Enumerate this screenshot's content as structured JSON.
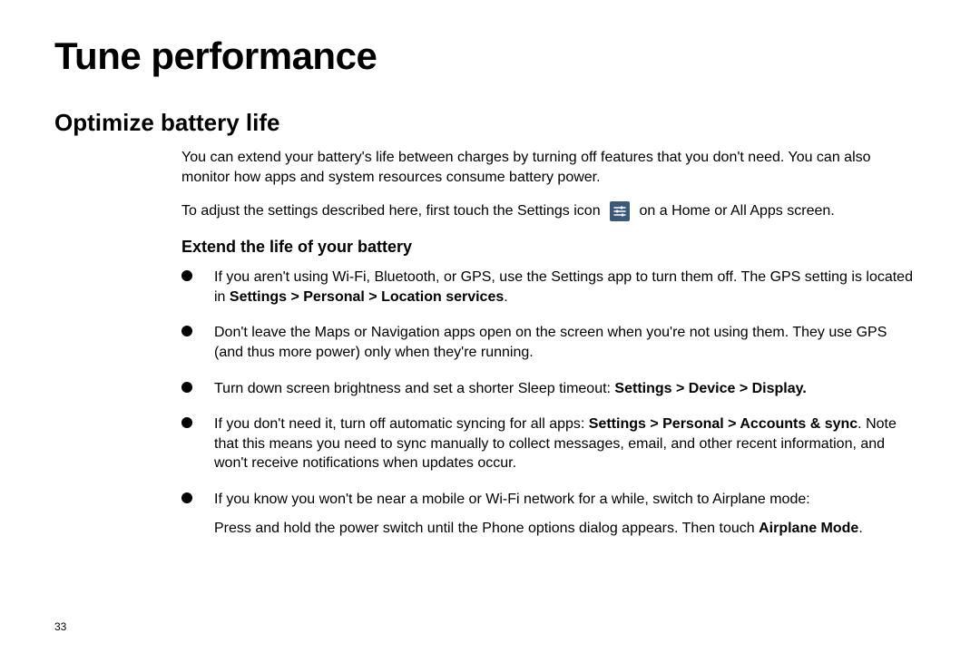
{
  "page": {
    "number": "33",
    "h1": "Tune performance",
    "h2": "Optimize battery life",
    "intro1": "You can extend your battery's life between charges by turning off features that you don't need. You can also monitor how apps and system resources consume battery power.",
    "intro2_a": "To adjust the settings described here, first touch the Settings icon ",
    "intro2_b": " on a Home or All Apps screen.",
    "h3": "Extend the life of your battery",
    "bullets": {
      "b1_a": "If you aren't using Wi-Fi, Bluetooth, or GPS, use the Settings app to turn them off. The GPS setting is located in ",
      "b1_bold": "Settings > Personal > Location services",
      "b1_c": ".",
      "b2": "Don't leave the Maps or Navigation apps open on the screen when you're not using them. They use GPS (and thus more power) only when they're running.",
      "b3_a": "Turn down screen brightness and set a shorter Sleep timeout: ",
      "b3_bold": "Settings > Device > Display.",
      "b4_a": "If you don't need it, turn off automatic syncing for all apps: ",
      "b4_bold": "Settings > Personal > Accounts & sync",
      "b4_c": ". Note that this means you need to sync manually to collect messages, email, and other recent information, and won't receive notifications when updates occur.",
      "b5_a": "If you know you won't be near a mobile or Wi-Fi network for a while, switch to Airplane mode:",
      "b5_sub_a": "Press and hold the power switch until the Phone options dialog appears. Then touch ",
      "b5_sub_bold": "Airplane Mode",
      "b5_sub_c": "."
    },
    "icon_name": "settings-sliders-icon"
  }
}
